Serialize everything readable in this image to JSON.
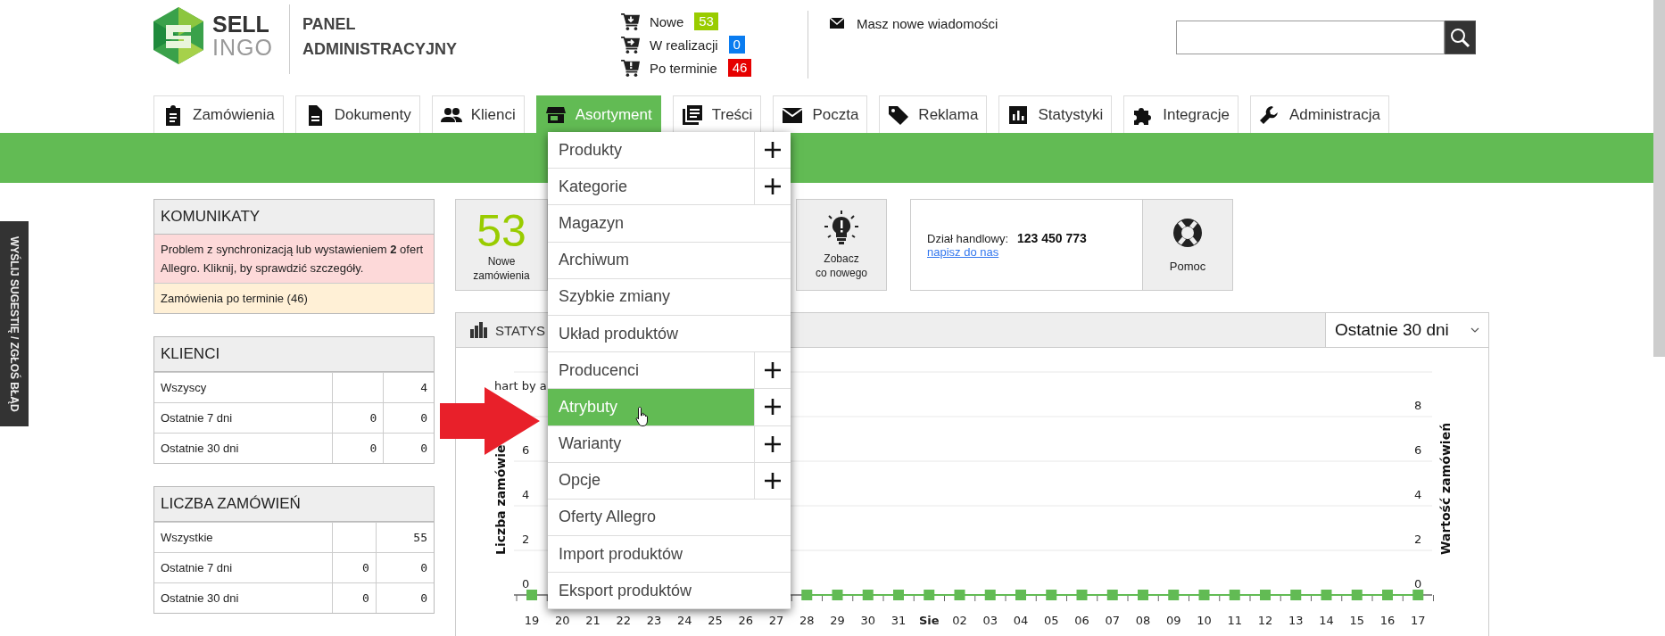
{
  "side_tab": {
    "label": "WYŚLIJ SUGESTIĘ / ZGŁOŚ BŁĄD"
  },
  "header": {
    "logo": {
      "line_1": "SELL",
      "line_2": "INGO"
    },
    "title_lines": [
      "PANEL",
      "ADMINISTRACYJNY"
    ],
    "order_status": [
      {
        "label": "Nowe",
        "count": "53",
        "color": "#99cc00"
      },
      {
        "label": "W realizacji",
        "count": "0",
        "color": "#0a7cf0"
      },
      {
        "label": "Po terminie",
        "count": "46",
        "color": "#e60000"
      }
    ],
    "messages": {
      "label": "Masz nowe wiadomości"
    }
  },
  "nav": {
    "tabs": [
      {
        "label": "Zamówienia",
        "selected": false
      },
      {
        "label": "Dokumenty",
        "selected": false
      },
      {
        "label": "Klienci",
        "selected": false
      },
      {
        "label": "Asortyment",
        "selected": true
      },
      {
        "label": "Treści",
        "selected": false
      },
      {
        "label": "Poczta",
        "selected": false
      },
      {
        "label": "Reklama",
        "selected": false
      },
      {
        "label": "Statystyki",
        "selected": false
      },
      {
        "label": "Integracje",
        "selected": false
      },
      {
        "label": "Administracja",
        "selected": false
      }
    ]
  },
  "menu": {
    "items": [
      {
        "label": "Produkty",
        "has_add": true,
        "selected": false
      },
      {
        "label": "Kategorie",
        "has_add": true,
        "selected": false
      },
      {
        "label": "Magazyn",
        "has_add": false,
        "selected": false
      },
      {
        "label": "Archiwum",
        "has_add": false,
        "selected": false
      },
      {
        "label": "Szybkie zmiany",
        "has_add": false,
        "selected": false
      },
      {
        "label": "Układ produktów",
        "has_add": false,
        "selected": false
      },
      {
        "label": "Producenci",
        "has_add": true,
        "selected": false
      },
      {
        "label": "Atrybuty",
        "has_add": true,
        "selected": true
      },
      {
        "label": "Warianty",
        "has_add": true,
        "selected": false
      },
      {
        "label": "Opcje",
        "has_add": true,
        "selected": false
      },
      {
        "label": "Oferty Allegro",
        "has_add": false,
        "selected": false
      },
      {
        "label": "Import produktów",
        "has_add": false,
        "selected": false
      },
      {
        "label": "Eksport produktów",
        "has_add": false,
        "selected": false
      }
    ]
  },
  "komunikaty": {
    "title": "KOMUNIKATY",
    "messages": [
      {
        "kind": "error",
        "text": "Problem z synchronizacją lub wystawieniem **2** ofert Allegro. Kliknij, by sprawdzić szczegóły."
      },
      {
        "kind": "warning",
        "text": "Zamówienia po terminie (46)"
      }
    ]
  },
  "klienci": {
    "title": "KLIENCI",
    "rows": [
      {
        "label": "Wszyscy",
        "column_3": "4"
      },
      {
        "label": "Ostatnie 7 dni",
        "column_2": "0",
        "column_3": "0"
      },
      {
        "label": "Ostatnie 30 dni",
        "column_2": "0",
        "column_3": "0"
      }
    ]
  },
  "liczba_zamowien": {
    "title": "LICZBA ZAMÓWIEŃ",
    "rows": [
      {
        "label": "Wszystkie",
        "column_3": "55"
      },
      {
        "label": "Ostatnie 7 dni",
        "column_2": "0",
        "column_3": "0"
      },
      {
        "label": "Ostatnie 30 dni",
        "column_2": "0",
        "column_3": "0"
      }
    ]
  },
  "tiles": [
    {
      "kind": "count",
      "value": "53",
      "lines": [
        "Nowe",
        "zamówienia"
      ]
    },
    {
      "kind": "bulb",
      "lines": [
        "Zobacz",
        "co nowego"
      ]
    }
  ],
  "contact": {
    "label": "Dział handlowy:",
    "phone": "123 450 773",
    "link": "napisz do nas",
    "help": "Pomoc"
  },
  "statistics": {
    "title": "STATYS",
    "period": "Ostatnie 30 dni",
    "right_axis": {
      "label": "Wartość zamówień",
      "ticks": [
        "8",
        "6",
        "4",
        "2",
        "0"
      ]
    },
    "chart_data": {
      "type": "line",
      "title": "hart by a",
      "ylabel": "Liczba zamówie",
      "categories": [
        "19",
        "20",
        "21",
        "22",
        "23",
        "24",
        "25",
        "26",
        "27",
        "28",
        "29",
        "30",
        "31",
        "Sie",
        "02",
        "03",
        "04",
        "05",
        "06",
        "07",
        "08",
        "09",
        "10",
        "11",
        "12",
        "13",
        "14",
        "15",
        "16",
        "17"
      ],
      "series": [
        {
          "color": "#62bb54",
          "marker": "square",
          "values": [
            0,
            null,
            null,
            null,
            null,
            null,
            null,
            null,
            null,
            0,
            0,
            0,
            0,
            0,
            0,
            0,
            0,
            0,
            0,
            0,
            0,
            0,
            0,
            0,
            0,
            0,
            0,
            0,
            0,
            0
          ]
        }
      ],
      "grid": true,
      "ylim": [
        0,
        10
      ],
      "yticks": [
        {
          "value": 0,
          "label": "0"
        },
        {
          "value": 2,
          "label": "2"
        },
        {
          "value": 4,
          "label": "4"
        },
        {
          "value": 6,
          "label": "6"
        }
      ]
    }
  }
}
